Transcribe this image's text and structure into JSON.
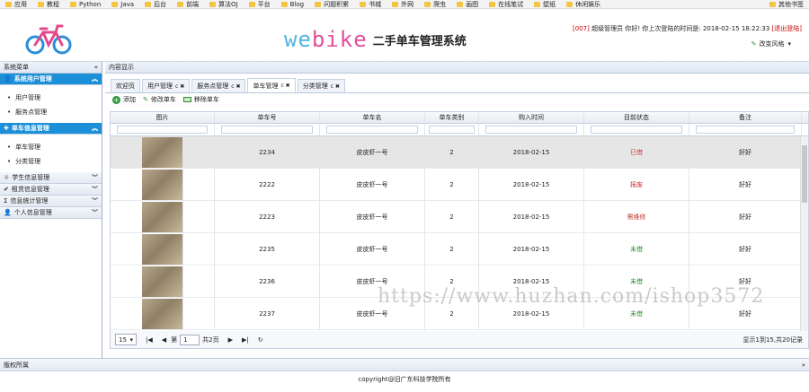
{
  "bookmarks": [
    "应用",
    "教程",
    "Python",
    "Java",
    "后台",
    "前端",
    "算法OJ",
    "平台",
    "Blog",
    "问题积累",
    "书城",
    "外网",
    "爬虫",
    "画图",
    "在线笔试",
    "壁纸",
    "休闲娱乐"
  ],
  "other_bookmarks": "其他书签",
  "header": {
    "brand_a": "we",
    "brand_b": "bike",
    "subtitle": "二手单车管理系统",
    "user_id": "[007]",
    "user_text": "超级管理员 你好! 你上次登陆的时间是: 2018-02-15 18:22:33",
    "logout": "[退出登陆]",
    "style_label": "改变风格"
  },
  "sidebar": {
    "title": "系统菜单",
    "groups": [
      {
        "label": "系统用户管理",
        "items": [
          "用户管理",
          "服务点管理"
        ]
      },
      {
        "label": "单车信息管理",
        "items": [
          "单车管理",
          "分类管理"
        ]
      },
      {
        "label": "学生信息管理"
      },
      {
        "label": "租赁信息管理"
      },
      {
        "label": "信息统计管理"
      },
      {
        "label": "个人信息管理"
      }
    ]
  },
  "main": {
    "title": "内容显示",
    "tabs": [
      {
        "label": "欢迎页"
      },
      {
        "label": "用户管理"
      },
      {
        "label": "服务点管理"
      },
      {
        "label": "单车管理"
      },
      {
        "label": "分类管理"
      }
    ],
    "toolbar": {
      "add": "添加",
      "edit": "修改单车",
      "remove": "移除单车"
    },
    "columns": [
      "图片",
      "单车号",
      "单车名",
      "单车类别",
      "购入时间",
      "目前状态",
      "备注"
    ],
    "rows": [
      {
        "no": "2234",
        "name": "皮皮虾一号",
        "type": "2",
        "date": "2018-02-15",
        "status": "已借",
        "note": "好好"
      },
      {
        "no": "2222",
        "name": "皮皮虾一号",
        "type": "2",
        "date": "2018-02-15",
        "status": "报废",
        "note": "好好"
      },
      {
        "no": "2223",
        "name": "皮皮虾一号",
        "type": "2",
        "date": "2018-02-15",
        "status": "需维修",
        "note": "好好"
      },
      {
        "no": "2235",
        "name": "皮皮虾一号",
        "type": "2",
        "date": "2018-02-15",
        "status": "未借",
        "note": "好好"
      },
      {
        "no": "2236",
        "name": "皮皮虾一号",
        "type": "2",
        "date": "2018-02-15",
        "status": "未借",
        "note": "好好"
      },
      {
        "no": "2237",
        "name": "皮皮虾一号",
        "type": "2",
        "date": "2018-02-15",
        "status": "未借",
        "note": "好好"
      }
    ],
    "pager": {
      "size": "15",
      "page_label": "第",
      "page": "1",
      "total_pages": "共2页",
      "info": "显示1到15,共20记录"
    }
  },
  "footer": {
    "title": "版权所属",
    "copyright": "copyright@旧广东科技学院所有"
  },
  "watermark": "https://www.huzhan.com/ishop3572",
  "colors": {
    "accent": "#1b8fd8",
    "status_lent": "#d9343a",
    "status_scrapped": "#d9343a",
    "status_repair": "#c0392b",
    "status_free": "#2e8b2e"
  }
}
